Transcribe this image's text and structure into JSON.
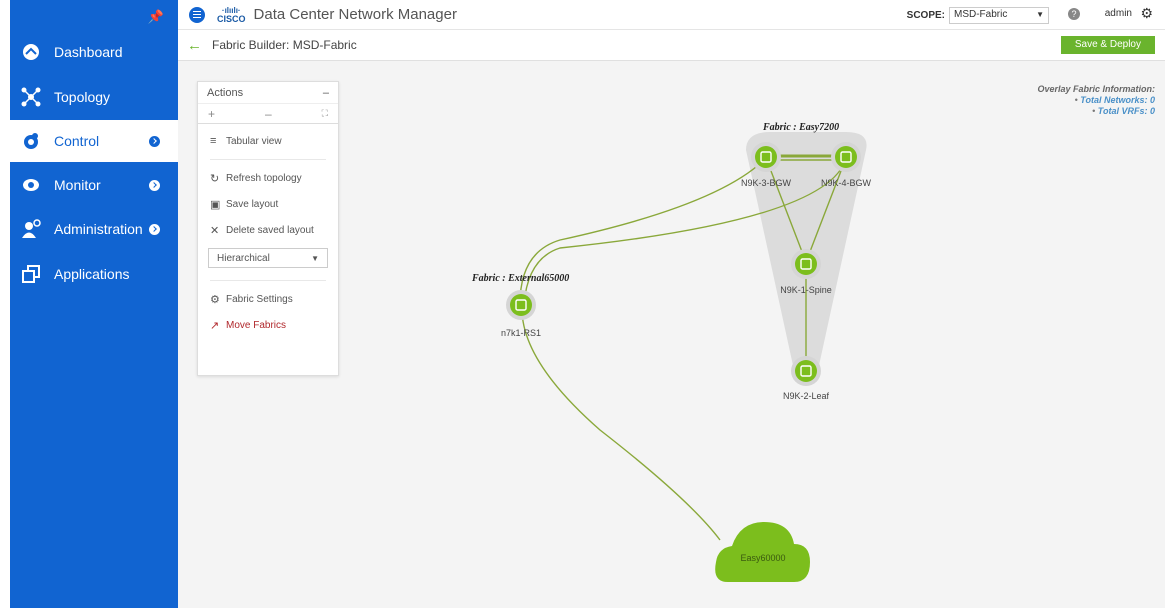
{
  "app": {
    "title": "Data Center Network Manager",
    "logo_bars": "·ılıılı·",
    "logo_text": "CISCO",
    "scope_label": "SCOPE:",
    "scope_value": "MSD-Fabric",
    "user": "admin"
  },
  "sidebar": {
    "items": [
      {
        "label": "Dashboard",
        "icon": "dashboard-icon"
      },
      {
        "label": "Topology",
        "icon": "topology-icon"
      },
      {
        "label": "Control",
        "icon": "control-icon",
        "active": true
      },
      {
        "label": "Monitor",
        "icon": "eye-icon"
      },
      {
        "label": "Administration",
        "icon": "admin-icon"
      },
      {
        "label": "Applications",
        "icon": "applications-icon"
      }
    ]
  },
  "subheader": {
    "title": "Fabric Builder: MSD-Fabric",
    "save_deploy": "Save & Deploy"
  },
  "actions": {
    "title": "Actions",
    "tabular_view": "Tabular view",
    "refresh": "Refresh topology",
    "save_layout": "Save layout",
    "delete_layout": "Delete saved layout",
    "layout_select": "Hierarchical",
    "fabric_settings": "Fabric Settings",
    "move_fabrics": "Move Fabrics"
  },
  "overlay": {
    "title": "Overlay Fabric Information:",
    "networks_label": "Total Networks:",
    "networks_value": "0",
    "vrfs_label": "Total VRFs:",
    "vrfs_value": "0"
  },
  "topology": {
    "fabrics": [
      "Fabric : Easy7200",
      "Fabric : External65000"
    ],
    "nodes": [
      "N9K-3-BGW",
      "N9K-4-BGW",
      "N9K-1-Spine",
      "N9K-2-Leaf",
      "n7k1-RS1"
    ],
    "cloud": "Easy60000"
  },
  "colors": {
    "sidebar": "#1164d1",
    "node": "#7cbe1d",
    "link": "#8aa83a",
    "accent_green": "#6ab42d"
  }
}
